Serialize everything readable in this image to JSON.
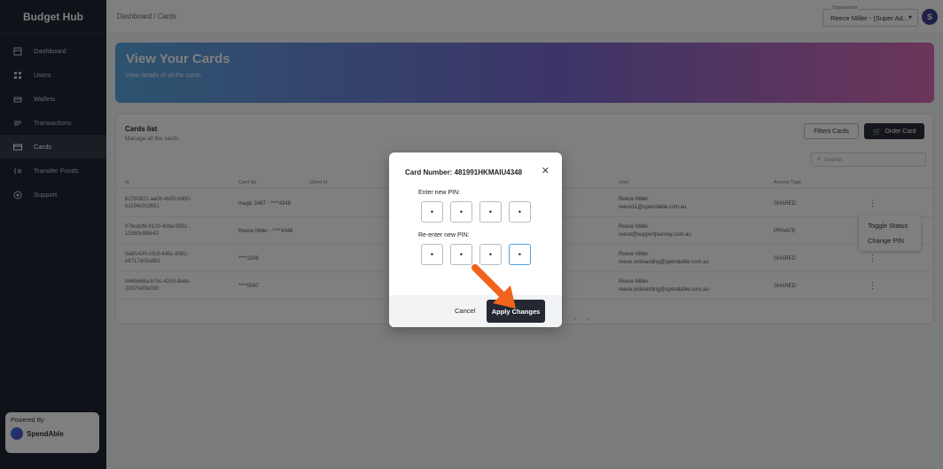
{
  "brand": "Budget Hub",
  "sidebar": {
    "items": [
      {
        "label": "Dashboard"
      },
      {
        "label": "Users"
      },
      {
        "label": "Wallets"
      },
      {
        "label": "Transactions"
      },
      {
        "label": "Cards"
      },
      {
        "label": "Transfer Funds"
      },
      {
        "label": "Support"
      }
    ],
    "powered_by": "Powered By",
    "powered_logo": "SpendAble"
  },
  "topbar": {
    "breadcrumb": "Dashboard / Cards",
    "org_label": "Organisation",
    "org_value": "Reece Miller - (Super Ad...",
    "avatar": "S"
  },
  "hero": {
    "title": "View Your Cards",
    "subtitle": "View details of all the cards"
  },
  "panel": {
    "title": "Cards list",
    "subtitle": "Manage all the cards",
    "filter_button": "Filters Cards",
    "order_button": "Order Card",
    "search_placeholder": "Search",
    "columns": [
      "Id",
      "Card No",
      "Client Id",
      "User",
      "Access Type"
    ],
    "rows": [
      {
        "id": "617b0821-aa0b-4b05-bdd0-e1194c0c2b51",
        "card_no": "magic 3467 - ****4348",
        "user_name": "Reece Miller",
        "user_email": "reece11@spendable.com.au",
        "access": "SHARED"
      },
      {
        "id": "076cdcf9-4129-406a-9951-15360c8f8e42",
        "card_no": "Reece Miller - ****4348",
        "user_name": "Reece Miller",
        "user_email": "reece@supportjourney.com.au",
        "access": "PRIVATE"
      },
      {
        "id": "0a6fc420-c0c8-445c-8081-e6717dc5a881",
        "card_no": "****1506",
        "user_name": "Reece Miller",
        "user_email": "reece.onboarding@spendable.com.au",
        "access": "SHARED"
      },
      {
        "id": "0469e66a-b7dc-4250-9eeb-20020ef0e930",
        "card_no": "****0047",
        "user_name": "Reece Miller",
        "user_email": "reece.onboarding@spendable.com.au",
        "access": "SHARED"
      }
    ]
  },
  "context_menu": {
    "toggle": "Toggle Status",
    "change_pin": "Change PIN"
  },
  "modal": {
    "title": "Card Number: 481991HKMAIU4348",
    "close": "✕",
    "enter_label": "Enter new PIN:",
    "reenter_label": "Re-enter new PIN:",
    "pin_dot": "•",
    "cancel": "Cancel",
    "apply": "Apply Changes"
  },
  "colors": {
    "sidebar_bg": "#1f2430",
    "accent_dark": "#232833",
    "arrow": "#f2641e"
  }
}
